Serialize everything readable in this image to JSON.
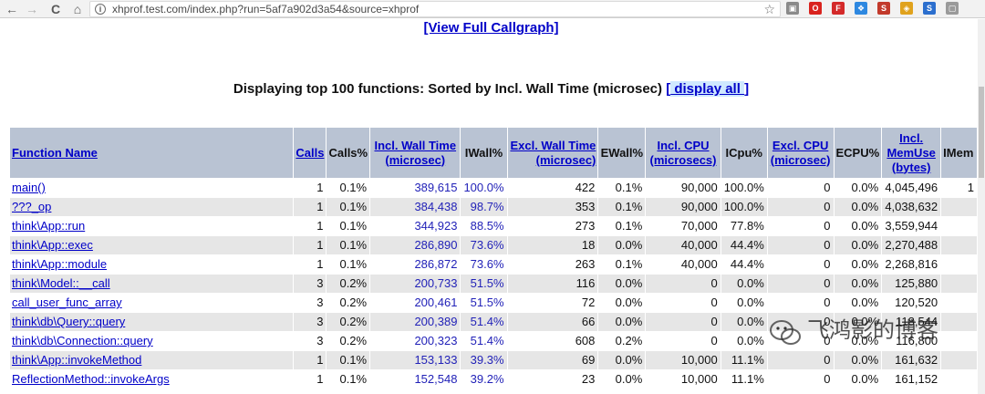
{
  "browser": {
    "url": "xhprof.test.com/index.php?run=5af7a902d3a54&source=xhprof",
    "back_icon": "←",
    "forward_icon": "→",
    "reload_icon": "C",
    "home_icon": "⌂",
    "info_icon": "i",
    "star_icon": "☆",
    "extensions": [
      {
        "name": "gray-extension-icon",
        "glyph": "▣",
        "color": "#8a8a8a"
      },
      {
        "name": "opera-extension-icon",
        "glyph": "O",
        "color": "#d9231e"
      },
      {
        "name": "red-extension-icon",
        "glyph": "F",
        "color": "#d42a2a"
      },
      {
        "name": "colorful-extension-icon",
        "glyph": "❖",
        "color": "#2e88e0"
      },
      {
        "name": "red-box-extension-icon",
        "glyph": "S",
        "color": "#c23a2b"
      },
      {
        "name": "yellow-extension-icon",
        "glyph": "◈",
        "color": "#e0a21d"
      },
      {
        "name": "blue-extension-icon",
        "glyph": "S",
        "color": "#2c6fce"
      },
      {
        "name": "window-extension-icon",
        "glyph": "▢",
        "color": "#9a9a9a"
      }
    ]
  },
  "page": {
    "callgraph_link": "[View Full Callgraph]",
    "heading_text": "Displaying top 100 functions: Sorted by Incl. Wall Time (microsec) ",
    "heading_open": "[",
    "display_all_link": " display all ",
    "heading_close": "]"
  },
  "table": {
    "headers": {
      "function_name": "Function Name",
      "calls": "Calls",
      "calls_pct": "Calls%",
      "incl_wall_1": "Incl. Wall Time",
      "incl_wall_2": "(microsec)",
      "iwall_pct": "IWall%",
      "excl_wall_1": "Excl. Wall Time",
      "excl_wall_2": "(microsec)",
      "ewall_pct": "EWall%",
      "incl_cpu_1": "Incl. CPU",
      "incl_cpu_2": "(microsecs)",
      "icpu_pct": "ICpu%",
      "excl_cpu_1": "Excl. CPU",
      "excl_cpu_2": "(microsec)",
      "ecpu_pct": "ECPU%",
      "incl_mem_1": "Incl.",
      "incl_mem_2": "MemUse",
      "incl_mem_3": "(bytes)",
      "imem_pct": "IMem"
    },
    "rows": [
      {
        "fn": "main()",
        "calls": "1",
        "calls_pct": "0.1%",
        "iwall": "389,615",
        "iwall_pct": "100.0%",
        "ewall": "422",
        "ewall_pct": "0.1%",
        "icpu": "90,000",
        "icpu_pct": "100.0%",
        "ecpu": "0",
        "ecpu_pct": "0.0%",
        "imem": "4,045,496",
        "imem_pct": "1"
      },
      {
        "fn": "???_op",
        "calls": "1",
        "calls_pct": "0.1%",
        "iwall": "384,438",
        "iwall_pct": "98.7%",
        "ewall": "353",
        "ewall_pct": "0.1%",
        "icpu": "90,000",
        "icpu_pct": "100.0%",
        "ecpu": "0",
        "ecpu_pct": "0.0%",
        "imem": "4,038,632",
        "imem_pct": ""
      },
      {
        "fn": "think\\App::run",
        "calls": "1",
        "calls_pct": "0.1%",
        "iwall": "344,923",
        "iwall_pct": "88.5%",
        "ewall": "273",
        "ewall_pct": "0.1%",
        "icpu": "70,000",
        "icpu_pct": "77.8%",
        "ecpu": "0",
        "ecpu_pct": "0.0%",
        "imem": "3,559,944",
        "imem_pct": ""
      },
      {
        "fn": "think\\App::exec",
        "calls": "1",
        "calls_pct": "0.1%",
        "iwall": "286,890",
        "iwall_pct": "73.6%",
        "ewall": "18",
        "ewall_pct": "0.0%",
        "icpu": "40,000",
        "icpu_pct": "44.4%",
        "ecpu": "0",
        "ecpu_pct": "0.0%",
        "imem": "2,270,488",
        "imem_pct": ""
      },
      {
        "fn": "think\\App::module",
        "calls": "1",
        "calls_pct": "0.1%",
        "iwall": "286,872",
        "iwall_pct": "73.6%",
        "ewall": "263",
        "ewall_pct": "0.1%",
        "icpu": "40,000",
        "icpu_pct": "44.4%",
        "ecpu": "0",
        "ecpu_pct": "0.0%",
        "imem": "2,268,816",
        "imem_pct": ""
      },
      {
        "fn": "think\\Model::__call",
        "calls": "3",
        "calls_pct": "0.2%",
        "iwall": "200,733",
        "iwall_pct": "51.5%",
        "ewall": "116",
        "ewall_pct": "0.0%",
        "icpu": "0",
        "icpu_pct": "0.0%",
        "ecpu": "0",
        "ecpu_pct": "0.0%",
        "imem": "125,880",
        "imem_pct": ""
      },
      {
        "fn": "call_user_func_array",
        "calls": "3",
        "calls_pct": "0.2%",
        "iwall": "200,461",
        "iwall_pct": "51.5%",
        "ewall": "72",
        "ewall_pct": "0.0%",
        "icpu": "0",
        "icpu_pct": "0.0%",
        "ecpu": "0",
        "ecpu_pct": "0.0%",
        "imem": "120,520",
        "imem_pct": ""
      },
      {
        "fn": "think\\db\\Query::query",
        "calls": "3",
        "calls_pct": "0.2%",
        "iwall": "200,389",
        "iwall_pct": "51.4%",
        "ewall": "66",
        "ewall_pct": "0.0%",
        "icpu": "0",
        "icpu_pct": "0.0%",
        "ecpu": "0",
        "ecpu_pct": "0.0%",
        "imem": "118,544",
        "imem_pct": ""
      },
      {
        "fn": "think\\db\\Connection::query",
        "calls": "3",
        "calls_pct": "0.2%",
        "iwall": "200,323",
        "iwall_pct": "51.4%",
        "ewall": "608",
        "ewall_pct": "0.2%",
        "icpu": "0",
        "icpu_pct": "0.0%",
        "ecpu": "0",
        "ecpu_pct": "0.0%",
        "imem": "116,800",
        "imem_pct": ""
      },
      {
        "fn": "think\\App::invokeMethod",
        "calls": "1",
        "calls_pct": "0.1%",
        "iwall": "153,133",
        "iwall_pct": "39.3%",
        "ewall": "69",
        "ewall_pct": "0.0%",
        "icpu": "10,000",
        "icpu_pct": "11.1%",
        "ecpu": "0",
        "ecpu_pct": "0.0%",
        "imem": "161,632",
        "imem_pct": ""
      },
      {
        "fn": "ReflectionMethod::invokeArgs",
        "calls": "1",
        "calls_pct": "0.1%",
        "iwall": "152,548",
        "iwall_pct": "39.2%",
        "ewall": "23",
        "ewall_pct": "0.0%",
        "icpu": "10,000",
        "icpu_pct": "11.1%",
        "ecpu": "0",
        "ecpu_pct": "0.0%",
        "imem": "161,152",
        "imem_pct": ""
      }
    ]
  },
  "watermark": {
    "text": "飞鸿影的博客",
    "icon": "wechat-icon"
  },
  "colors": {
    "link": "#0000c8",
    "header_bg": "#b9c3d3",
    "row_alt": "#e6e6e6"
  }
}
